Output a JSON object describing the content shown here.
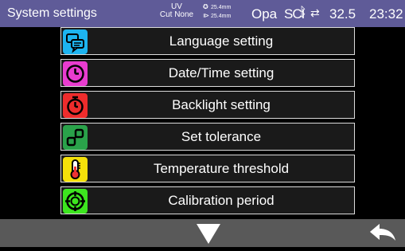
{
  "status_bar": {
    "title": "System settings",
    "uv_top": "UV",
    "uv_bottom": "Cut None",
    "dia_top": "25.4mm",
    "dia_bottom": "25.4mm",
    "opa": "Opa",
    "sc": "SCI",
    "bluetooth_icon": "bluetooth-icon",
    "usb_icon": "usb-icon",
    "temperature": "32.5",
    "clock": "23:32"
  },
  "menu": {
    "items": [
      {
        "label": "Language setting",
        "icon": "language-icon",
        "color": "#1db4f0"
      },
      {
        "label": "Date/Time setting",
        "icon": "clock-icon",
        "color": "#e83ccf"
      },
      {
        "label": "Backlight setting",
        "icon": "timer-icon",
        "color": "#ee2c2c"
      },
      {
        "label": "Set tolerance",
        "icon": "tolerance-icon",
        "color": "#2aa24a"
      },
      {
        "label": "Temperature threshold",
        "icon": "thermometer-icon",
        "color": "#f5e10a"
      },
      {
        "label": "Calibration period",
        "icon": "calibration-icon",
        "color": "#3de51f"
      }
    ]
  },
  "bottom_bar": {
    "down_icon": "arrow-down-icon",
    "back_icon": "back-arrow-icon"
  }
}
